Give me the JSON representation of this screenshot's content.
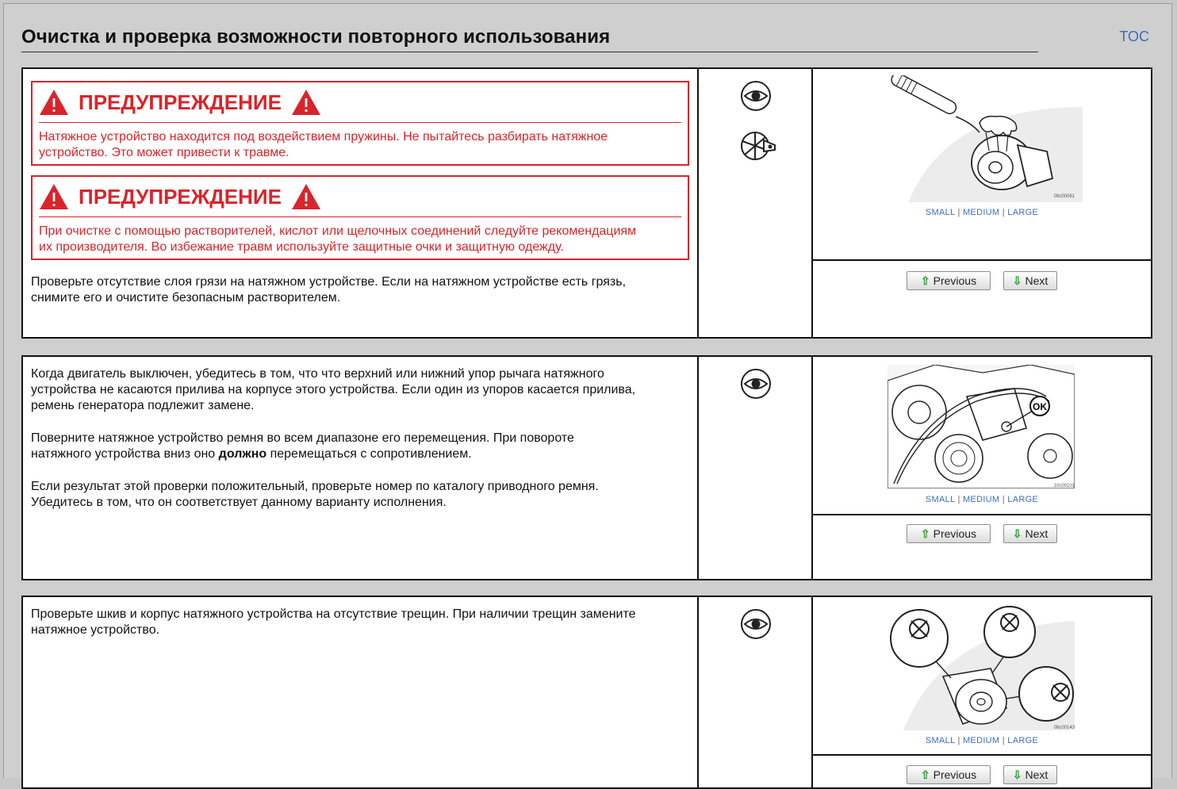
{
  "header": {
    "title": "Очистка и проверка возможности повторного использования",
    "toc_label": "TOC"
  },
  "steps": [
    {
      "warnings": [
        {
          "heading": "ПРЕДУПРЕЖДЕНИЕ",
          "line1": "Натяжное устройство находится под воздействием пружины. Не пытайтесь разбирать натяжное",
          "line2": "устройство. Это может привести к травме."
        },
        {
          "heading": "ПРЕДУПРЕЖДЕНИЕ",
          "line1": "При очистке с помощью растворителей, кислот или щелочных соединений следуйте рекомендациям",
          "line2": "их производителя. Во избежание травм используйте защитные очки и защитную одежду."
        }
      ],
      "text_line1": "Проверьте отсутствие слоя грязи на натяжном устройстве. Если на натяжном устройстве есть грязь,",
      "text_line2": "снимите его и очистите безопасным растворителем.",
      "image_code": "09c00061"
    },
    {
      "p1_line1": "Когда двигатель выключен, убедитесь в том, что что верхний или нижний упор рычага натяжного",
      "p1_line2": "устройства не касаются прилива на корпусе этого устройства. Если один из упоров касается прилива,",
      "p1_line3": "ремень генератора подлежит замене.",
      "p2_line1": "Поверните натяжное устройство ремня во всем диапазоне его перемещения. При повороте",
      "p2_line2a": "натяжного устройства вниз оно ",
      "p2_bold": "должно",
      "p2_line2b": " перемещаться с сопротивлением.",
      "p3_line1": "Если результат этой проверки положительный, проверьте номер по каталогу приводного ремня.",
      "p3_line2": "Убедитесь в том, что он соответствует данному варианту исполнения.",
      "image_label": "OK",
      "image_code": "10c00101"
    },
    {
      "text_line1": "Проверьте шкив и корпус натяжного устройства на отсутствие трещин. При наличии трещин замените",
      "text_line2": "натяжное устройство.",
      "image_code": "09c00143"
    }
  ],
  "image_sizes": {
    "small": "SMALL",
    "medium": "MEDIUM",
    "large": "LARGE",
    "sep": "|"
  },
  "nav": {
    "previous": "Previous",
    "next": "Next"
  },
  "colors": {
    "warning": "#d9242a",
    "link": "#3a6fb5",
    "nav_arrow": "#2f9a2f"
  }
}
